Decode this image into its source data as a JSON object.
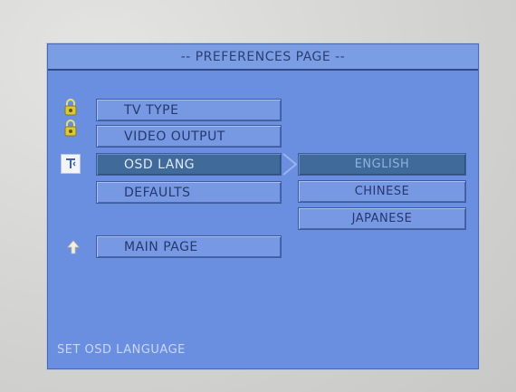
{
  "title": "-- PREFERENCES PAGE --",
  "menu": {
    "items": [
      {
        "label": "TV TYPE",
        "icon": "lock-icon"
      },
      {
        "label": "VIDEO OUTPUT",
        "icon": "lock-icon"
      },
      {
        "label": "OSD LANG",
        "icon": "osd-text-icon",
        "selected": true
      },
      {
        "label": "DEFAULTS"
      }
    ],
    "main_page": {
      "label": "MAIN PAGE",
      "icon": "up-arrow-icon"
    }
  },
  "submenu": {
    "options": [
      {
        "label": "ENGLISH",
        "selected": true
      },
      {
        "label": "CHINESE"
      },
      {
        "label": "JAPANESE"
      }
    ]
  },
  "status": "SET OSD LANGUAGE",
  "colors": {
    "panel": "#6a8fe0",
    "button": "#7799e4",
    "selected": "#3f6a9a",
    "text": "#26386c"
  }
}
